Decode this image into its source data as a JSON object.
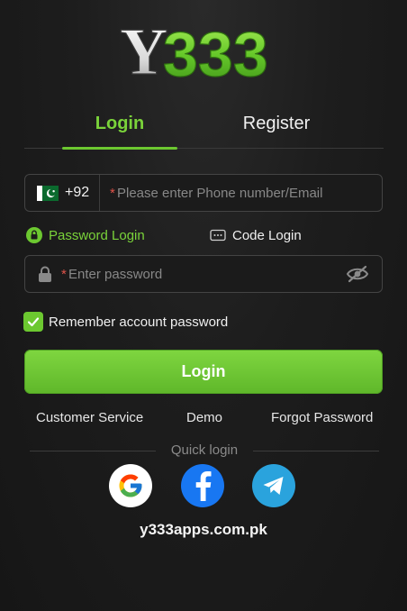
{
  "brand": {
    "logo_text": "Y333",
    "accent": "#6cc830"
  },
  "tabs": {
    "login": "Login",
    "register": "Register"
  },
  "phone": {
    "country_code": "+92",
    "flag": "pakistan-flag",
    "required_mark": "*",
    "placeholder": "Please enter Phone number/Email"
  },
  "login_modes": {
    "password": "Password Login",
    "code": "Code Login"
  },
  "password": {
    "required_mark": "*",
    "placeholder": "Enter password"
  },
  "remember": {
    "label": "Remember account password",
    "checked": true
  },
  "login_button": "Login",
  "links": {
    "customer_service": "Customer Service",
    "demo": "Demo",
    "forgot": "Forgot Password"
  },
  "quick_login": {
    "label": "Quick login",
    "providers": [
      "google-icon",
      "facebook-icon",
      "telegram-icon"
    ]
  },
  "site": "y333apps.com.pk"
}
